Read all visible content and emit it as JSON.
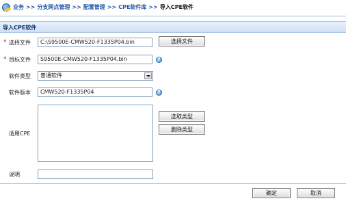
{
  "breadcrumb": {
    "items": [
      "业务",
      "分支网点管理",
      "配置管理",
      "CPE软件库"
    ],
    "separator": ">>",
    "current": "导入CPE软件"
  },
  "panel": {
    "title": "导入CPE软件"
  },
  "form": {
    "select_file": {
      "label": "选择文件",
      "value": "C:\\S9500E-CMW520-F1335P04.bin",
      "button": "选择文件"
    },
    "target_file": {
      "label": "目标文件",
      "value": "S9500E-CMW520-F1335P04.bin",
      "help": "?"
    },
    "software_type": {
      "label": "软件类型",
      "selected": "普通软件"
    },
    "software_version": {
      "label": "软件版本",
      "value": "CMW520-F1335P04",
      "help": "?"
    },
    "applicable_cpe": {
      "label": "适用CPE",
      "add_button": "选取类型",
      "remove_button": "删除类型"
    },
    "description": {
      "label": "说明",
      "value": ""
    }
  },
  "required_mark": "*",
  "footer": {
    "ok": "确定",
    "cancel": "取消"
  },
  "colors": {
    "link": "#2459a8",
    "panel_title_bg": "#cfe0f4",
    "required": "#d40000"
  },
  "icons": {
    "breadcrumb": "globe-icon",
    "help": "help-icon",
    "dropdown": "chevron-down-icon"
  }
}
